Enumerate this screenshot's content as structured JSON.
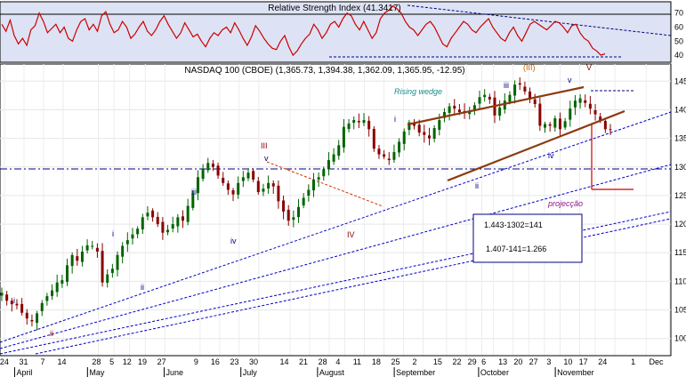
{
  "chart_data": [
    {
      "type": "line",
      "title": "Relative Strength Index (41.3417)",
      "ylim": [
        35,
        78
      ],
      "y_ticks": [
        40,
        50,
        60,
        70
      ],
      "x_index_range": [
        0,
        145
      ],
      "series": [
        {
          "values": [
            62,
            57,
            65,
            54,
            48,
            52,
            47,
            58,
            61,
            70,
            64,
            56,
            59,
            62,
            56,
            60,
            52,
            50,
            58,
            64,
            66,
            58,
            62,
            57,
            68,
            71,
            62,
            56,
            58,
            64,
            60,
            52,
            55,
            60,
            64,
            57,
            54,
            58,
            64,
            68,
            62,
            57,
            52,
            56,
            63,
            58,
            53,
            55,
            50,
            46,
            52,
            56,
            54,
            58,
            60,
            56,
            63,
            58,
            52,
            47,
            53,
            61,
            57,
            52,
            48,
            45,
            44,
            50,
            54,
            46,
            40,
            43,
            48,
            52,
            55,
            62,
            58,
            52,
            56,
            62,
            64,
            60,
            66,
            70,
            68,
            62,
            58,
            64,
            58,
            52,
            56,
            66,
            70,
            72,
            75,
            73,
            70,
            64,
            60,
            58,
            54,
            58,
            62,
            64,
            60,
            54,
            48,
            46,
            52,
            56,
            60,
            64,
            62,
            58,
            56,
            60,
            63,
            66,
            60,
            56,
            52,
            50,
            56,
            60,
            54,
            50,
            56,
            62,
            64,
            62,
            60,
            58,
            61,
            64,
            63,
            60,
            56,
            61,
            62,
            56,
            52,
            50,
            45,
            43,
            40,
            41
          ]
        }
      ]
    },
    {
      "type": "line",
      "title": "NASDAQ 100 (CBOE) (1,365.73, 1,394.38, 1,362.09, 1,365.95, -12.95)",
      "ylim": [
        970,
        1480
      ],
      "y_ticks": [
        1000,
        1050,
        1100,
        1150,
        1200,
        1250,
        1300,
        1350,
        1400,
        1450
      ],
      "x_index_range": [
        0,
        145
      ],
      "x_ticks": [
        {
          "i": 0,
          "label": "24"
        },
        {
          "i": 5,
          "label": "31"
        },
        {
          "i": 10,
          "label": "7"
        },
        {
          "i": 15,
          "label": "14"
        },
        {
          "i": 24,
          "label": "28"
        },
        {
          "i": 28,
          "label": "5"
        },
        {
          "i": 32,
          "label": "12"
        },
        {
          "i": 36,
          "label": "19"
        },
        {
          "i": 41,
          "label": "27"
        },
        {
          "i": 50,
          "label": "9"
        },
        {
          "i": 55,
          "label": "16"
        },
        {
          "i": 60,
          "label": "23"
        },
        {
          "i": 65,
          "label": "30"
        },
        {
          "i": 73,
          "label": "14"
        },
        {
          "i": 78,
          "label": "21"
        },
        {
          "i": 83,
          "label": "28"
        },
        {
          "i": 87,
          "label": "4"
        },
        {
          "i": 92,
          "label": "11"
        },
        {
          "i": 97,
          "label": "18"
        },
        {
          "i": 102,
          "label": "25"
        },
        {
          "i": 107,
          "label": "2"
        },
        {
          "i": 113,
          "label": "15"
        },
        {
          "i": 118,
          "label": "22"
        },
        {
          "i": 122,
          "label": "29"
        },
        {
          "i": 125,
          "label": "6"
        },
        {
          "i": 130,
          "label": "13"
        },
        {
          "i": 134,
          "label": "20"
        },
        {
          "i": 138,
          "label": "27"
        },
        {
          "i": 142,
          "label": "3"
        },
        {
          "i": 147,
          "label": "10"
        },
        {
          "i": 151,
          "label": "17"
        },
        {
          "i": 156,
          "label": "24"
        },
        {
          "i": 164,
          "label": "1"
        },
        {
          "i": 170,
          "label": "Dec"
        }
      ],
      "months": [
        {
          "i": 5,
          "label": "April"
        },
        {
          "i": 24,
          "label": "May"
        },
        {
          "i": 44,
          "label": "June"
        },
        {
          "i": 64,
          "label": "July"
        },
        {
          "i": 84,
          "label": "August"
        },
        {
          "i": 104,
          "label": "September"
        },
        {
          "i": 126,
          "label": "October"
        },
        {
          "i": 146,
          "label": "November"
        }
      ],
      "series": [
        {
          "values": [
            1080,
            1066,
            1060,
            1058,
            1045,
            1035,
            1030,
            1044,
            1062,
            1074,
            1084,
            1098,
            1102,
            1128,
            1146,
            1136,
            1152,
            1163,
            1162,
            1152,
            1098,
            1112,
            1122,
            1146,
            1162,
            1172,
            1182,
            1192,
            1212,
            1220,
            1212,
            1200,
            1185,
            1190,
            1200,
            1212,
            1206,
            1232,
            1254,
            1282,
            1296,
            1307,
            1300,
            1285,
            1272,
            1260,
            1252,
            1272,
            1282,
            1290,
            1278,
            1256,
            1262,
            1272,
            1266,
            1240,
            1222,
            1206,
            1212,
            1230,
            1246,
            1260,
            1278,
            1282,
            1296,
            1312,
            1322,
            1338,
            1370,
            1376,
            1382,
            1378,
            1382,
            1366,
            1332,
            1322,
            1318,
            1312,
            1326,
            1344,
            1362,
            1378,
            1372,
            1360,
            1356,
            1350,
            1368,
            1382,
            1396,
            1406,
            1402,
            1396,
            1394,
            1398,
            1408,
            1422,
            1426,
            1418,
            1390,
            1404,
            1416,
            1426,
            1444,
            1444,
            1432,
            1418,
            1410,
            1372,
            1375,
            1372,
            1385,
            1366,
            1380,
            1402,
            1416,
            1420,
            1412,
            1402,
            1392,
            1382,
            1366,
            1365
          ]
        }
      ],
      "labels": [
        {
          "text": "Rising wedge",
          "color": "#1a8a8a"
        },
        {
          "text": "projecção",
          "color": "#8a1a8a"
        },
        {
          "text": "1.443-1302=141",
          "color": "#000000"
        },
        {
          "text": "1.407-141=1.266",
          "color": "#000000"
        }
      ],
      "wave_labels": [
        {
          "text": "i",
          "color": "#000080"
        },
        {
          "text": "ii",
          "color": "#8a0000"
        },
        {
          "text": "i",
          "color": "#000080"
        },
        {
          "text": "ii",
          "color": "#000080"
        },
        {
          "text": "iii",
          "color": "#000080"
        },
        {
          "text": "iv",
          "color": "#000080"
        },
        {
          "text": "v",
          "color": "#000080"
        },
        {
          "text": "III",
          "color": "#8a0000"
        },
        {
          "text": "IV",
          "color": "#8a0000"
        },
        {
          "text": "i",
          "color": "#000080"
        },
        {
          "text": "ii",
          "color": "#000080"
        },
        {
          "text": "iii",
          "color": "#000080"
        },
        {
          "text": "iv",
          "color": "#000080"
        },
        {
          "text": "v",
          "color": "#000080"
        },
        {
          "text": "(III)",
          "color": "#cc6600"
        },
        {
          "text": "V",
          "color": "#8a0000"
        }
      ],
      "colors": {
        "up": "#006400",
        "down": "#8a0000",
        "wedge": "#8b3a0f",
        "channel": "#0000cc",
        "rsi": "#cc0000",
        "panel_bg": "#dde3f4"
      }
    }
  ]
}
